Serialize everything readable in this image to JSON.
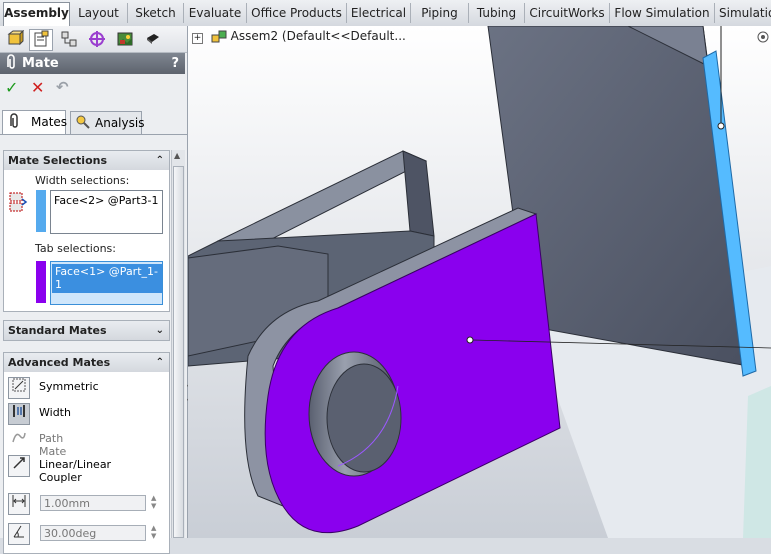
{
  "tabs": [
    "Assembly",
    "Layout",
    "Sketch",
    "Evaluate",
    "Office Products",
    "Electrical",
    "Piping",
    "Tubing",
    "CircuitWorks",
    "Flow Simulation",
    "Simulation"
  ],
  "active_tab": "Assembly",
  "property_manager": {
    "title": "Mate",
    "help": "?",
    "ok_symbol": "✓",
    "cancel_symbol": "✕",
    "undo_symbol": "↶",
    "tabs": [
      {
        "label": "Mates"
      },
      {
        "label": "Analysis"
      }
    ]
  },
  "mate_selections": {
    "header": "Mate Selections",
    "collapse": "⌃",
    "width_label": "Width selections:",
    "width_item": "Face<2> @Part3-1",
    "tab_label": "Tab selections:",
    "tab_item": "Face<1> @Part_1-1",
    "colors": {
      "width": "#55aaee",
      "tab": "#8a00ee"
    }
  },
  "standard_mates": {
    "header": "Standard Mates",
    "expand": "⌄"
  },
  "advanced_mates": {
    "header": "Advanced Mates",
    "collapse": "⌃",
    "items": [
      {
        "label": "Symmetric",
        "icon": "symmetric-icon"
      },
      {
        "label": "Width",
        "icon": "width-icon"
      },
      {
        "label": "Path Mate",
        "icon": "path-mate-icon"
      },
      {
        "label": "Linear/Linear Coupler",
        "icon": "linear-coupler-icon"
      }
    ],
    "distance_value": "1.00mm",
    "angle_value": "30.00deg"
  },
  "viewport": {
    "title": "Assem2  (Default<<Default...",
    "colors": {
      "part_gray": "#5c6474",
      "selected_purple": "#8a00ee",
      "selected_blue": "#55bbff",
      "background": "#dfe3e8"
    }
  }
}
